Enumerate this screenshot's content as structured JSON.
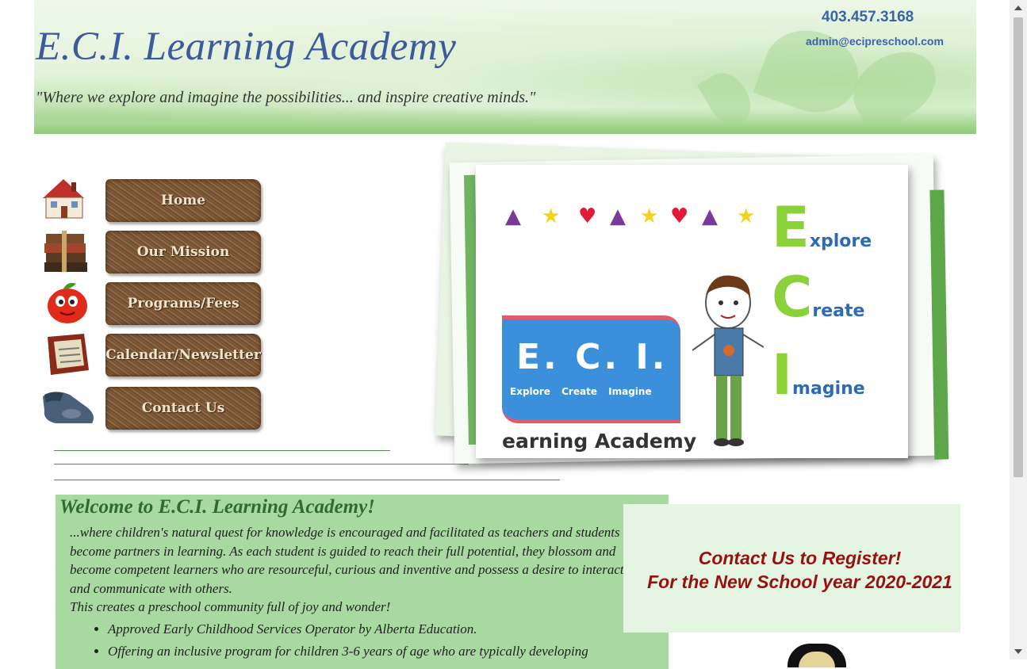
{
  "header": {
    "title": "E.C.I. Learning Academy",
    "tagline": "\"Where we explore and imagine the possibilities... and inspire creative minds.\"",
    "phone": "403.457.3168",
    "email": "admin@ecipreschool.com"
  },
  "nav": {
    "items": [
      {
        "label": "Home",
        "icon": "house-icon"
      },
      {
        "label": "Our Mission",
        "icon": "books-icon"
      },
      {
        "label": "Programs/Fees",
        "icon": "apple-icon"
      },
      {
        "label": "Calendar/Newsletter",
        "icon": "calendar-icon"
      },
      {
        "label": "Contact Us",
        "icon": "telephone-icon"
      }
    ]
  },
  "hero": {
    "eci_banner": "E. C. I.",
    "eci_sub": "Explore Create Imagine",
    "learning_text": "earning Academy",
    "word1_letter": "E",
    "word1_rest": "xplore",
    "word2_letter": "C",
    "word2_rest": "reate",
    "word3_letter": "I",
    "word3_rest": "magine"
  },
  "welcome": {
    "heading": "Welcome to E.C.I. Learning Academy!",
    "paragraph": "...where children's natural quest for knowledge is encouraged and facilitated as teachers and students become partners in learning. As each student is guided to reach their full potential, they blossom and become competent learners who are resourceful, curious and inventive and possess a desire to interact and communicate with others.",
    "paragraph2": "This creates a preschool community full of joy and wonder!",
    "bullets": [
      "Approved Early Childhood Services Operator by Alberta Education.",
      "Offering an inclusive program for children 3-6 years of age who are typically developing"
    ]
  },
  "register": {
    "line1": "Contact Us to Register!",
    "line2": "For the New School year 2020-2021"
  },
  "colors": {
    "title_blue": "#3c5a9c",
    "contact_blue": "#3a63a8",
    "welcome_bg": "#a7d9a0",
    "register_red": "#9a1010"
  }
}
